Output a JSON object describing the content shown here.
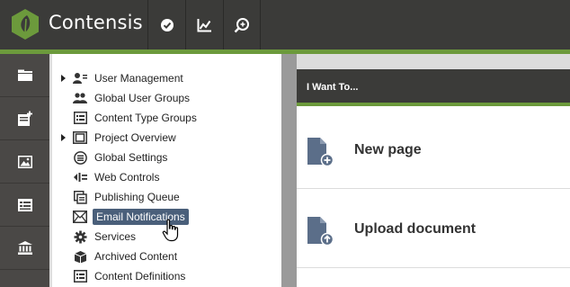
{
  "app": {
    "name": "Contensis",
    "accent_color": "#6c9a3c",
    "topbar_color": "#3b3b39"
  },
  "topbar": {
    "buttons": [
      {
        "icon": "check-circle-icon"
      },
      {
        "icon": "line-chart-icon"
      },
      {
        "icon": "search-settings-icon"
      }
    ]
  },
  "rail": {
    "items": [
      {
        "icon": "folder-icon"
      },
      {
        "icon": "new-content-icon"
      },
      {
        "icon": "image-icon"
      },
      {
        "icon": "form-icon"
      },
      {
        "icon": "bank-icon"
      }
    ]
  },
  "tree": {
    "selected_index": 7,
    "items": [
      {
        "label": "User Management",
        "expandable": true,
        "icon": "user-management-icon"
      },
      {
        "label": "Global User Groups",
        "expandable": false,
        "icon": "user-group-icon"
      },
      {
        "label": "Content Type Groups",
        "expandable": false,
        "icon": "content-type-icon"
      },
      {
        "label": "Project Overview",
        "expandable": true,
        "icon": "project-icon"
      },
      {
        "label": "Global Settings",
        "expandable": false,
        "icon": "settings-list-icon"
      },
      {
        "label": "Web Controls",
        "expandable": false,
        "icon": "web-controls-icon"
      },
      {
        "label": "Publishing Queue",
        "expandable": false,
        "icon": "queue-icon"
      },
      {
        "label": "Email Notifications",
        "expandable": false,
        "icon": "email-icon"
      },
      {
        "label": "Services",
        "expandable": false,
        "icon": "gear-icon"
      },
      {
        "label": "Archived Content",
        "expandable": false,
        "icon": "archive-icon"
      },
      {
        "label": "Content Definitions",
        "expandable": false,
        "icon": "definitions-icon"
      }
    ]
  },
  "iwant": {
    "title": "I Want To...",
    "actions": [
      {
        "label": "New page",
        "icon": "new-page-icon"
      },
      {
        "label": "Upload document",
        "icon": "upload-document-icon"
      }
    ]
  }
}
